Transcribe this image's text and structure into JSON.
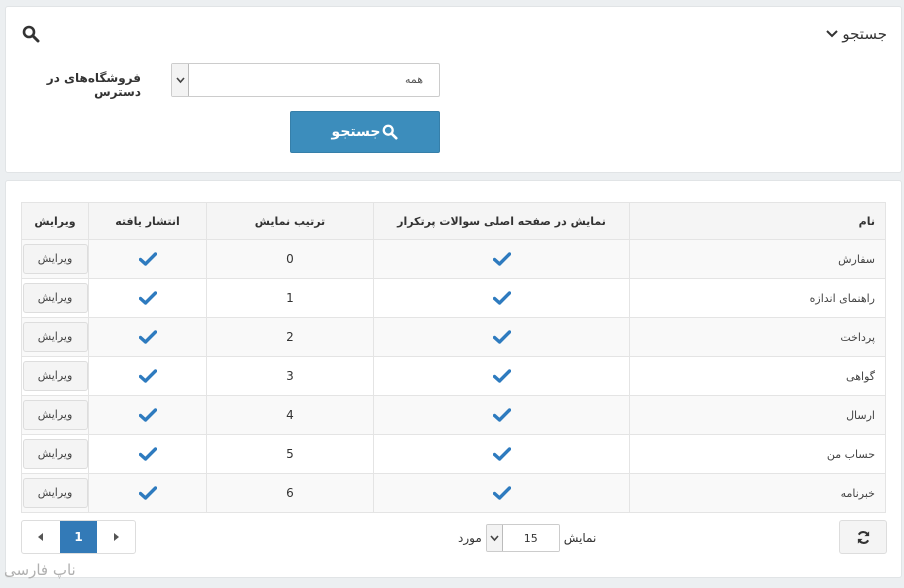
{
  "search": {
    "title": "جستجو",
    "store_label": "فروشگاه‌های در دسترس",
    "store_value": "همه",
    "button_label": "جستجو"
  },
  "table": {
    "headers": {
      "name": "نام",
      "show_on_home": "نمایش در صفحه اصلی سوالات پرتکرار",
      "display_order": "ترتیب نمایش",
      "published": "انتشار یافته",
      "edit": "ویرایش"
    },
    "rows": [
      {
        "name": "سفارش",
        "order": "0",
        "edit": "ویرایش"
      },
      {
        "name": "راهنمای اندازه",
        "order": "1",
        "edit": "ویرایش"
      },
      {
        "name": "پرداخت",
        "order": "2",
        "edit": "ویرایش"
      },
      {
        "name": "گواهی",
        "order": "3",
        "edit": "ویرایش"
      },
      {
        "name": "ارسال",
        "order": "4",
        "edit": "ویرایش"
      },
      {
        "name": "حساب من",
        "order": "5",
        "edit": "ویرایش"
      },
      {
        "name": "خبرنامه",
        "order": "6",
        "edit": "ویرایش"
      }
    ]
  },
  "pager": {
    "current_page": "1",
    "show_label": "نمایش",
    "page_size": "15",
    "items_label": "مورد"
  },
  "watermark": "ناپ فارسی",
  "colors": {
    "accent": "#3c8dbc",
    "check": "#2e7bbf",
    "active_page": "#337ab7"
  }
}
